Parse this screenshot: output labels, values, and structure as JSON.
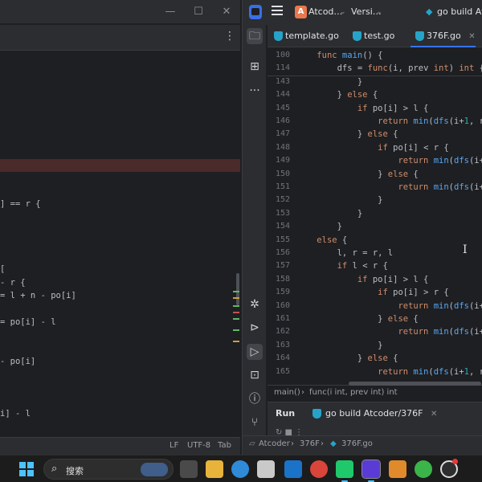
{
  "left_window": {
    "controls": {
      "minimize": "—",
      "maximize": "☐",
      "close": "✕"
    },
    "code_fragments": [
      "] == r {",
      "",
      "",
      "",
      "",
      "- r {",
      "= l + n - po[i]",
      "",
      "= po[i] - l",
      "",
      "",
      "- po[i]",
      "",
      "",
      "i] - l"
    ],
    "status": {
      "line_sep": "LF",
      "encoding": "UTF-8",
      "indent": "Tab"
    }
  },
  "right_window": {
    "title_bar": {
      "project_badge": "A",
      "project_name": "Atcod…",
      "vcs": "Versi…",
      "run_config": "go build Atco"
    },
    "tabs": [
      {
        "label": "template.go",
        "active": false
      },
      {
        "label": "test.go",
        "active": false
      },
      {
        "label": "376F.go",
        "active": true
      }
    ],
    "tab_close": "✕",
    "code_lines": [
      {
        "num": "100",
        "text": "    func main() {"
      },
      {
        "num": "114",
        "text": "        dfs = func(i, prev int) int {"
      },
      {
        "num": "143",
        "text": "            }"
      },
      {
        "num": "144",
        "text": "        } else {"
      },
      {
        "num": "145",
        "text": "            if po[i] > l {"
      },
      {
        "num": "146",
        "text": "                return min(dfs(i+1, r)+p"
      },
      {
        "num": "147",
        "text": "            } else {"
      },
      {
        "num": "148",
        "text": "                if po[i] < r {"
      },
      {
        "num": "149",
        "text": "                    return min(dfs(i+1,"
      },
      {
        "num": "150",
        "text": "                } else {"
      },
      {
        "num": "151",
        "text": "                    return min(dfs(i+1,"
      },
      {
        "num": "152",
        "text": "                }"
      },
      {
        "num": "153",
        "text": "            }"
      },
      {
        "num": "154",
        "text": "        }"
      },
      {
        "num": "155",
        "text": "    else {"
      },
      {
        "num": "156",
        "text": "        l, r = r, l"
      },
      {
        "num": "157",
        "text": "        if l < r {"
      },
      {
        "num": "158",
        "text": "            if po[i] > l {"
      },
      {
        "num": "159",
        "text": "                if po[i] > r {"
      },
      {
        "num": "160",
        "text": "                    return min(dfs(i+1,"
      },
      {
        "num": "161",
        "text": "                } else {"
      },
      {
        "num": "162",
        "text": "                    return min(dfs(i+1,"
      },
      {
        "num": "163",
        "text": "                }"
      },
      {
        "num": "164",
        "text": "            } else {"
      },
      {
        "num": "165",
        "text": "                return min(dfs(i+1, r)+l"
      }
    ],
    "breadcrumb": {
      "first": "main()",
      "second": "func(i int, prev int) int"
    },
    "run_panel": {
      "label": "Run",
      "tab": "go build Atcoder/376F"
    },
    "status_path": {
      "project": "Atcoder",
      "dir": "376F",
      "file": "376F.go"
    }
  },
  "taskbar": {
    "search_placeholder": "搜索",
    "apps": [
      "file-explorer",
      "edge-browser",
      "store",
      "mail",
      "chrome",
      "pycharm",
      "goland",
      "sublime-text",
      "wechat",
      "app-with-badge"
    ]
  },
  "colors": {
    "keyword": "#cf8e6d",
    "function": "#56a8f5",
    "number": "#2aacb8",
    "accent": "#3574f0",
    "error_line": "#4b2a2b"
  }
}
